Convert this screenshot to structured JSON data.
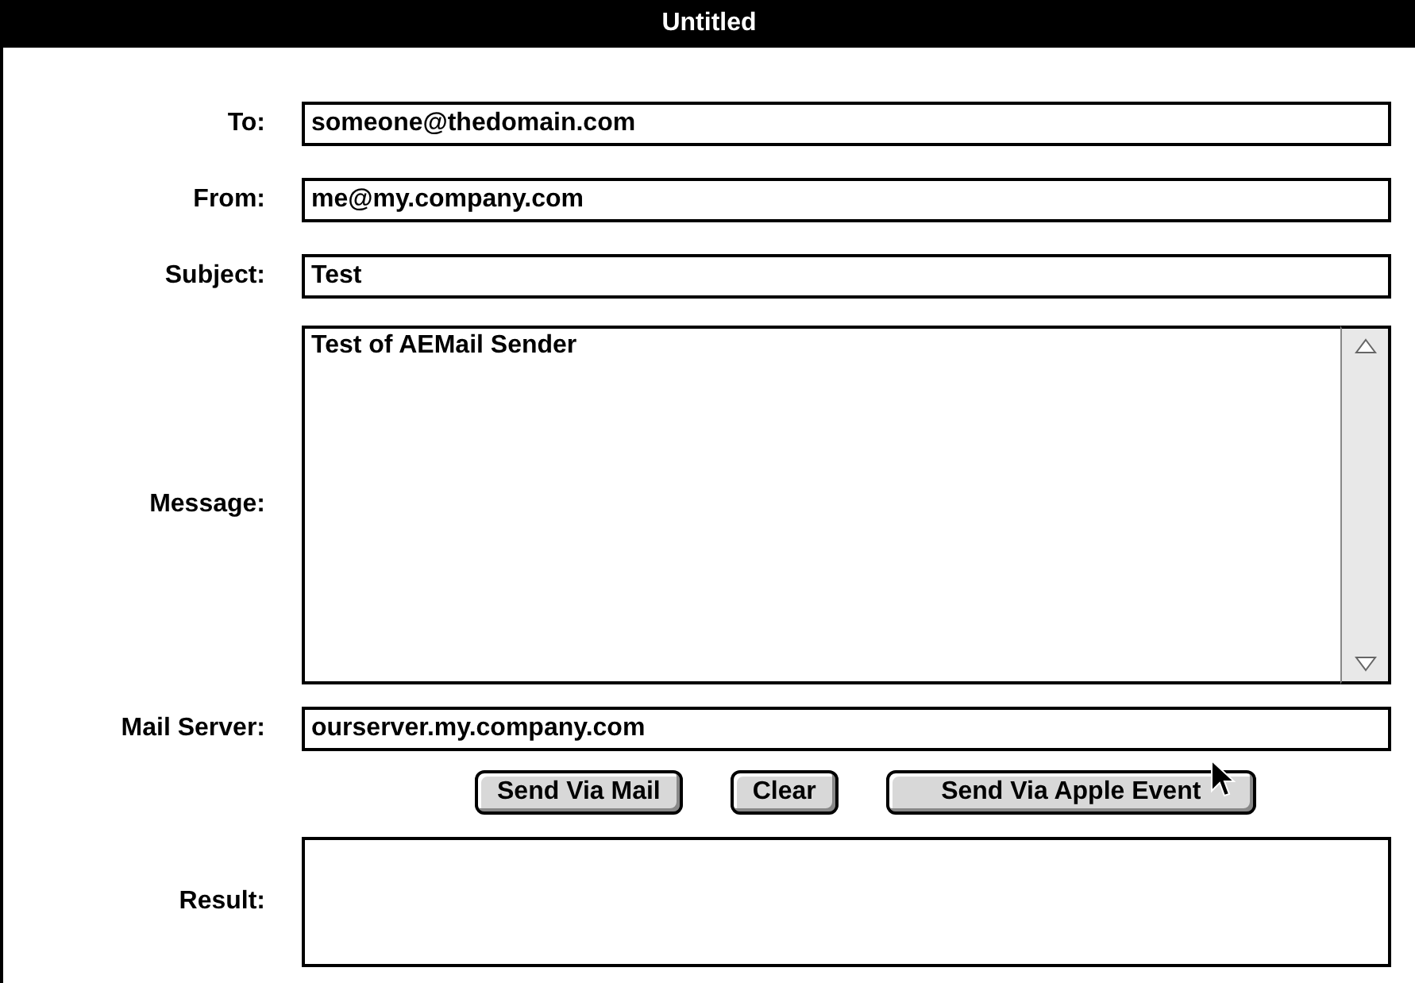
{
  "window": {
    "title": "Untitled"
  },
  "fields": [
    {
      "label": "To:",
      "value": "someone@thedomain.com",
      "kind": "line"
    },
    {
      "label": "From:",
      "value": "me@my.company.com",
      "kind": "line"
    },
    {
      "label": "Subject:",
      "value": "Test",
      "kind": "line"
    },
    {
      "label": "Message:",
      "value": "Test of AEMail Sender",
      "kind": "area"
    },
    {
      "label": "Mail Server:",
      "value": "ourserver.my.company.com",
      "kind": "line"
    }
  ],
  "buttons": [
    "Send Via Mail",
    "Clear",
    "Send Via Apple Event"
  ],
  "result": {
    "label": "Result:"
  }
}
